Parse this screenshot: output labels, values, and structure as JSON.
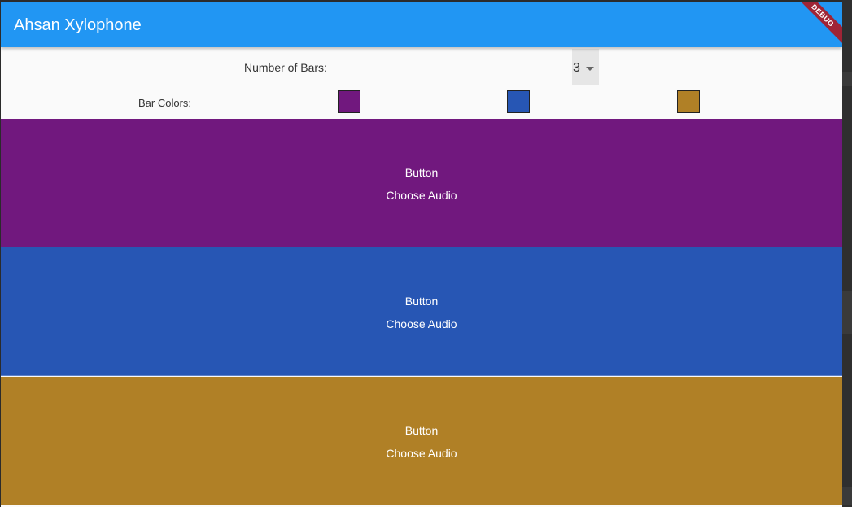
{
  "app": {
    "title": "Ahsan Xylophone",
    "debug_label": "DEBUG"
  },
  "controls": {
    "number_of_bars_label": "Number of Bars:",
    "number_of_bars_value": "3",
    "bar_colors_label": "Bar Colors:"
  },
  "colors": {
    "appbar": "#2196f3",
    "bar1": "#71187e",
    "bar2": "#2756b4",
    "bar3": "#b08026"
  },
  "bars": [
    {
      "button_label": "Button",
      "audio_label": "Choose Audio",
      "color": "#71187e"
    },
    {
      "button_label": "Button",
      "audio_label": "Choose Audio",
      "color": "#2756b4"
    },
    {
      "button_label": "Button",
      "audio_label": "Choose Audio",
      "color": "#b08026"
    }
  ]
}
